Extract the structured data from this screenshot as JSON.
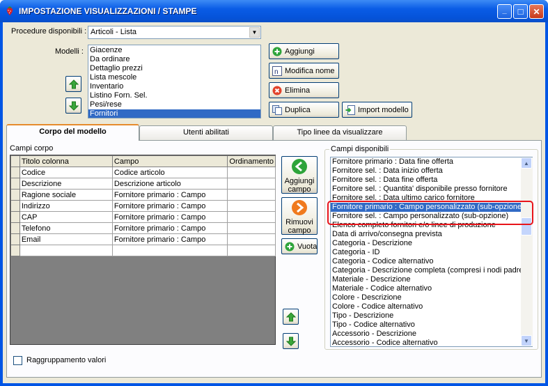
{
  "window": {
    "title": "IMPOSTAZIONE VISUALIZZAZIONI / STAMPE",
    "minimize": "_",
    "maximize": "□",
    "close": "✕"
  },
  "procedure": {
    "label": "Procedure disponibili :",
    "value": "Articoli - Lista"
  },
  "modelli": {
    "label": "Modelli :",
    "items": [
      "Giacenze",
      "Da ordinare",
      "Dettaglio prezzi",
      "Lista mescole",
      "Inventario",
      "Listino Forn. Sel.",
      "Pesi/rese",
      "Fornitori"
    ],
    "selected": "Fornitori"
  },
  "buttons": {
    "aggiungi": "Aggiungi",
    "modifica_nome": "Modifica nome",
    "elimina": "Elimina",
    "duplica": "Duplica",
    "import_modello": "Import modello"
  },
  "tabs": [
    "Corpo del modello",
    "Utenti abilitati",
    "Tipo linee da visualizzare"
  ],
  "campi_corpo": {
    "label": "Campi corpo",
    "columns": [
      "Titolo colonna",
      "Campo",
      "Ordinamento"
    ],
    "rows": [
      [
        "Codice",
        "Codice articolo",
        ""
      ],
      [
        "Descrizione",
        "Descrizione articolo",
        ""
      ],
      [
        "Ragione sociale",
        "Fornitore primario : Campo",
        ""
      ],
      [
        "Indirizzo",
        "Fornitore primario : Campo",
        ""
      ],
      [
        "CAP",
        "Fornitore primario : Campo",
        ""
      ],
      [
        "Telefono",
        "Fornitore primario : Campo",
        ""
      ],
      [
        "Email",
        "Fornitore primario : Campo",
        ""
      ]
    ]
  },
  "middle_buttons": {
    "aggiungi_campo": "Aggiungi campo",
    "rimuovi_campo": "Rimuovi campo",
    "vuota": "Vuota"
  },
  "campi_disponibili": {
    "label": "Campi disponibili",
    "items": [
      "Fornitore primario : Data fine offerta",
      "Fornitore sel. : Data inizio offerta",
      "Fornitore sel. : Data fine offerta",
      "Fornitore sel. : Quantita' disponibile presso fornitore",
      "Fornitore sel. : Data ultimo carico fornitore",
      "Fornitore primario : Campo personalizzato (sub-opzione)",
      "Fornitore sel. : Campo personalizzato (sub-opzione)",
      "Elenco completo fornitori e/o linee di produzione",
      "Data di arrivo/consegna prevista",
      "Categoria - Descrizione",
      "Categoria - ID",
      "Categoria - Codice alternativo",
      "Categoria - Descrizione completa (compresi i nodi padre)",
      "Materiale - Descrizione",
      "Materiale - Codice alternativo",
      "Colore - Descrizione",
      "Colore - Codice alternativo",
      "Tipo - Descrizione",
      "Tipo - Codice alternativo",
      "Accessorio - Descrizione",
      "Accessorio - Codice alternativo"
    ],
    "selected": "Fornitore primario : Campo personalizzato (sub-opzione)"
  },
  "raggruppamento": {
    "label": "Raggruppamento valori",
    "checked": false
  },
  "colors": {
    "selection": "#316ac5",
    "highlight_box": "#e8141a",
    "green_icon": "#2ea43a",
    "orange_icon": "#f07a1e"
  }
}
